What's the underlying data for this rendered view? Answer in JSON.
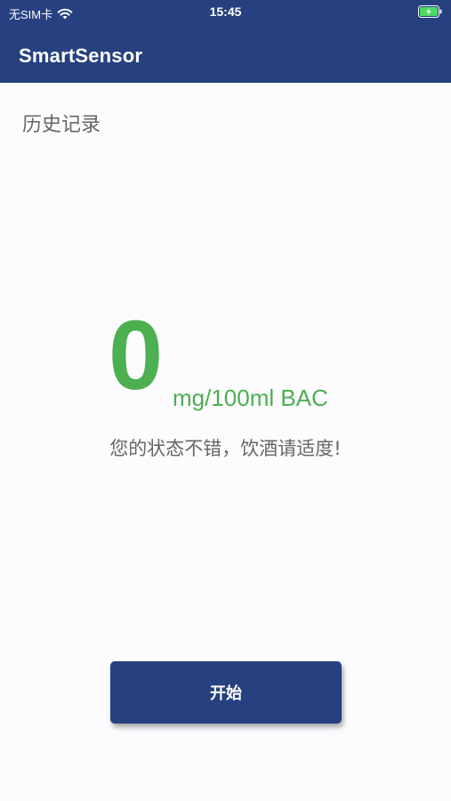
{
  "status_bar": {
    "carrier": "无SIM卡",
    "time": "15:45",
    "icons": [
      "wifi-icon",
      "battery-charging-icon"
    ]
  },
  "app_bar": {
    "title": "SmartSensor"
  },
  "main": {
    "history_label": "历史记录",
    "reading_value": "0",
    "reading_unit": "mg/100ml BAC",
    "status_message": "您的状态不错，饮酒请适度!",
    "start_button_label": "开始"
  },
  "colors": {
    "primary": "#27407f",
    "reading": "#4caf50",
    "text_secondary": "#666666",
    "background": "#fcfbfe",
    "battery": "#4cd964"
  }
}
